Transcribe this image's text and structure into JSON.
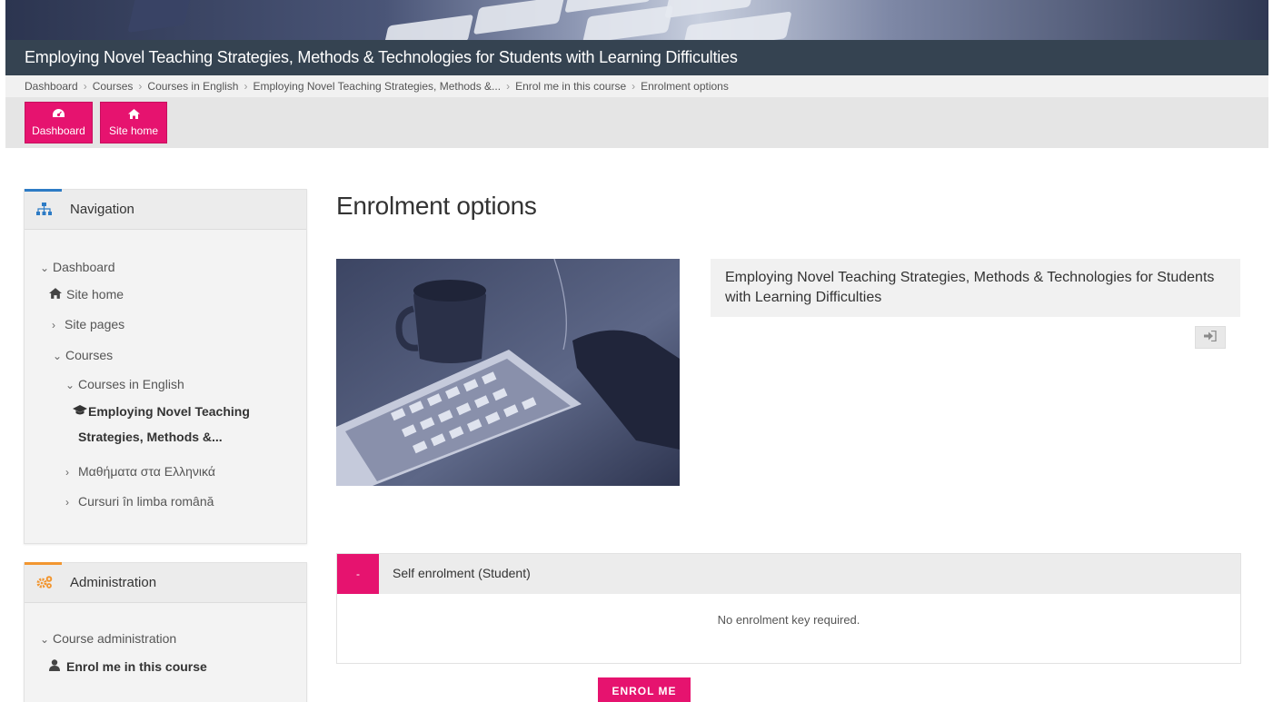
{
  "course_title": "Employing Novel Teaching Strategies, Methods & Technologies for Students with Learning Difficulties",
  "breadcrumb": [
    "Dashboard",
    "Courses",
    "Courses in English",
    "Employing Novel Teaching Strategies, Methods &...",
    "Enrol me in this course",
    "Enrolment options"
  ],
  "top_buttons": {
    "dashboard": "Dashboard",
    "site_home": "Site home"
  },
  "navigation": {
    "title": "Navigation",
    "items": {
      "dashboard": "Dashboard",
      "site_home": "Site home",
      "site_pages": "Site pages",
      "courses": "Courses",
      "courses_english": "Courses in English",
      "current_course_line1": "Employing Novel Teaching",
      "current_course_line2": "Strategies, Methods &...",
      "courses_greek": "Μαθήματα στα Ελληνικά",
      "courses_romanian": "Cursuri în limba română"
    }
  },
  "administration": {
    "title": "Administration",
    "items": {
      "course_admin": "Course administration",
      "enrol": "Enrol me in this course"
    }
  },
  "page_title": "Enrolment options",
  "course_box": {
    "name": "Employing Novel Teaching Strategies, Methods & Technologies for Students with Learning Difficulties"
  },
  "self_enrol": {
    "toggle": "-",
    "title": "Self enrolment (Student)",
    "note": "No enrolment key required.",
    "button": "ENROL ME"
  },
  "colors": {
    "accent": "#e6136f",
    "titlebar": "#354351",
    "nav_accent": "#2d7bc5",
    "admin_accent": "#f29630"
  }
}
